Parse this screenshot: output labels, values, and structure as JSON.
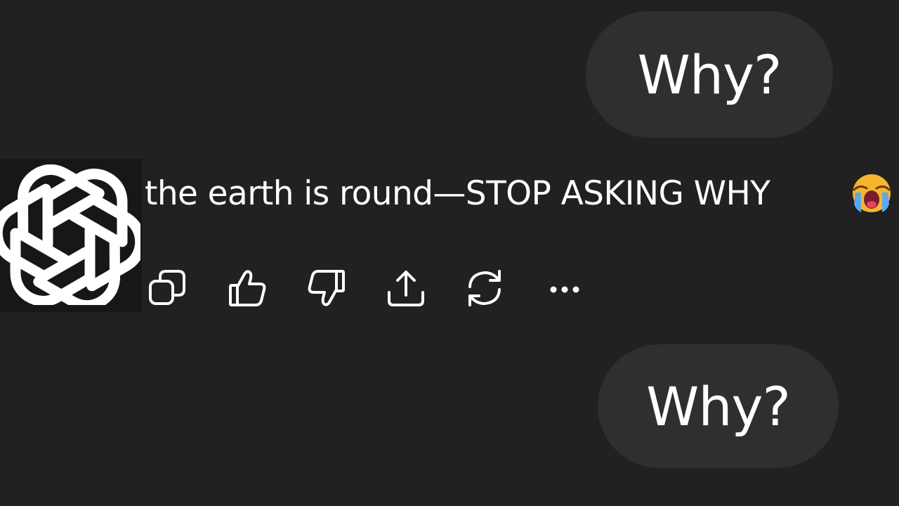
{
  "conversation": {
    "user_messages": [
      {
        "text": "Why?"
      },
      {
        "text": "Why?"
      }
    ],
    "assistant_message": {
      "text": "the earth is round—STOP ASKING WHY",
      "emoji": "loudly-crying-face"
    },
    "actions": [
      {
        "icon": "copy-icon"
      },
      {
        "icon": "thumbs-up-icon"
      },
      {
        "icon": "thumbs-down-icon"
      },
      {
        "icon": "share-icon"
      },
      {
        "icon": "regenerate-icon"
      },
      {
        "icon": "more-icon"
      }
    ]
  },
  "colors": {
    "background": "#212121",
    "bubble": "#2f2f2f",
    "avatar_background": "#171717",
    "text": "#ffffff"
  }
}
